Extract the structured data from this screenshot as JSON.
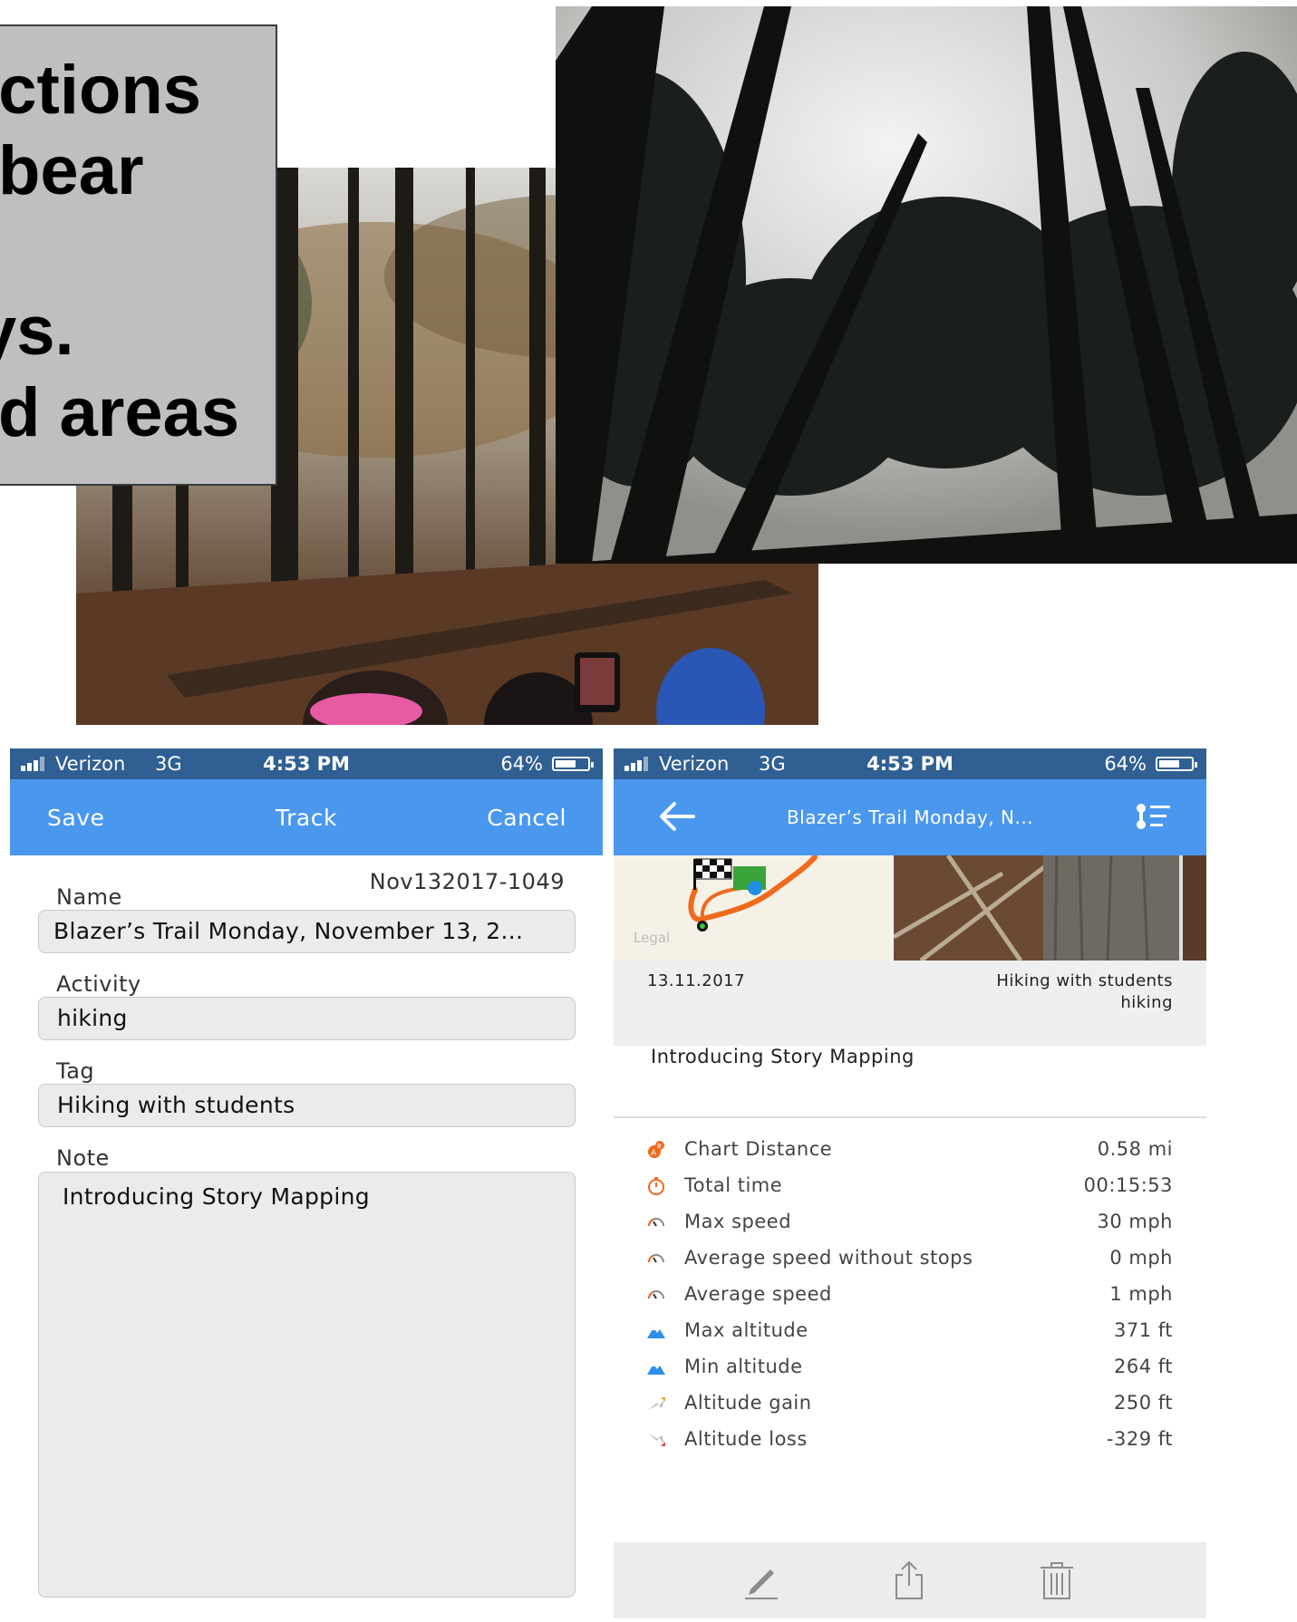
{
  "slide": {
    "caption_lines": [
      "ections",
      " bear",
      "",
      "ys.",
      "d areas"
    ]
  },
  "left_phone": {
    "status": {
      "carrier": "Verizon",
      "network": "3G",
      "time": "4:53 PM",
      "battery": "64%"
    },
    "nav": {
      "save": "Save",
      "title": "Track",
      "cancel": "Cancel"
    },
    "track_id": "Nov132017-1049",
    "fields": {
      "name_label": "Name",
      "name_value": "Blazer’s Trail Monday, November 13, 2...",
      "activity_label": "Activity",
      "activity_value": "hiking",
      "tag_label": "Tag",
      "tag_value": "Hiking with students",
      "note_label": "Note",
      "note_value": "Introducing Story Mapping"
    }
  },
  "right_phone": {
    "status": {
      "carrier": "Verizon",
      "network": "3G",
      "time": "4:53 PM",
      "battery": "64%"
    },
    "nav": {
      "title": "Blazer’s Trail Monday, N..."
    },
    "map_legal": "Legal",
    "date": "13.11.2017",
    "tag": "Hiking with students",
    "activity": "hiking",
    "note": "Introducing Story Mapping",
    "stats": [
      {
        "label": "Chart Distance",
        "value": "0.58 mi",
        "icon": "distance-icon"
      },
      {
        "label": "Total time",
        "value": "00:15:53",
        "icon": "stopwatch-icon"
      },
      {
        "label": "Max speed",
        "value": "30 mph",
        "icon": "speedometer-icon"
      },
      {
        "label": "Average speed without stops",
        "value": "0 mph",
        "icon": "speedometer-icon"
      },
      {
        "label": "Average speed",
        "value": "1 mph",
        "icon": "speedometer-icon"
      },
      {
        "label": "Max altitude",
        "value": "371 ft",
        "icon": "mountain-icon"
      },
      {
        "label": "Min altitude",
        "value": "264 ft",
        "icon": "mountain-icon"
      },
      {
        "label": "Altitude gain",
        "value": "250 ft",
        "icon": "arrow-up-icon"
      },
      {
        "label": "Altitude loss",
        "value": "-329 ft",
        "icon": "arrow-down-icon"
      }
    ]
  },
  "colors": {
    "status_bar": "#2f5f93",
    "nav_bar": "#4a97ee",
    "field_bg": "#ebebeb",
    "route": "#f06a1e"
  }
}
